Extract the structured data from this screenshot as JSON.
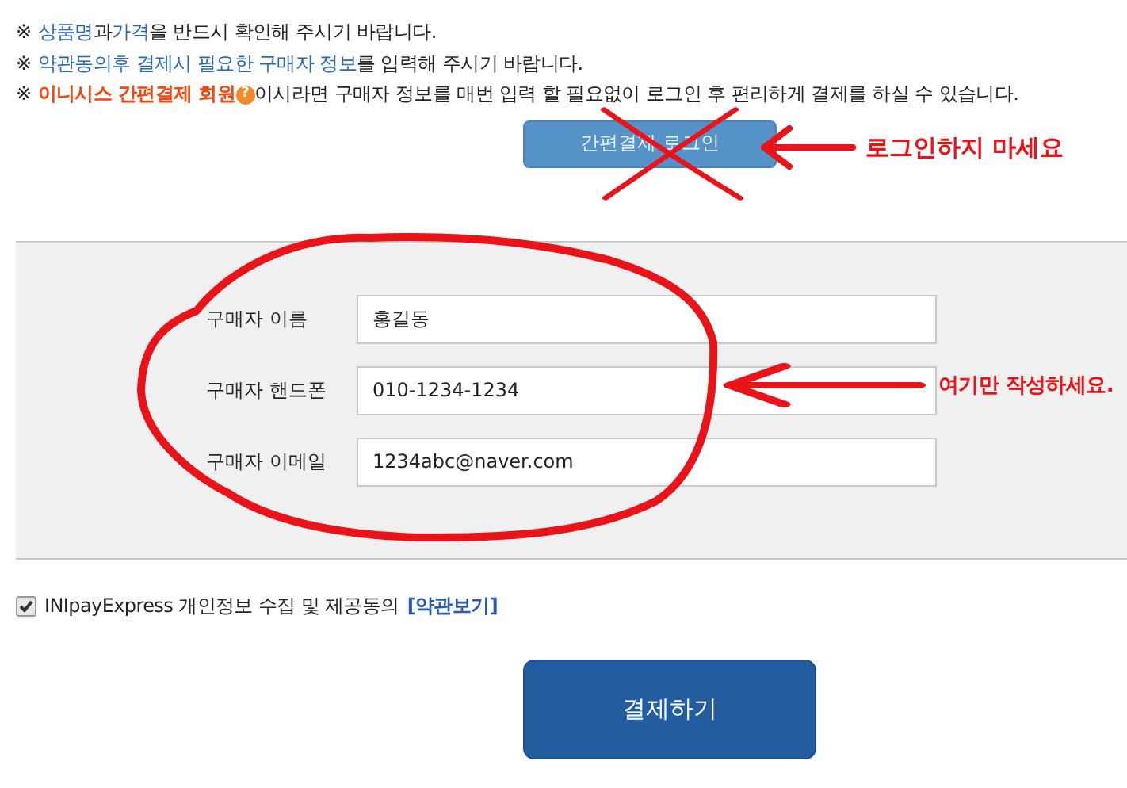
{
  "notices": [
    {
      "segments": [
        {
          "kind": "mark",
          "text": "※"
        },
        {
          "kind": "link",
          "text": "상품명"
        },
        {
          "kind": "plain",
          "text": "과 "
        },
        {
          "kind": "link",
          "text": "가격"
        },
        {
          "kind": "plain",
          "text": "을 반드시 확인해 주시기 바랍니다."
        }
      ]
    },
    {
      "segments": [
        {
          "kind": "mark",
          "text": "※"
        },
        {
          "kind": "link",
          "text": "약관동의후 결제시 필요한 구매자 정보"
        },
        {
          "kind": "plain",
          "text": "를 입력해 주시기 바랍니다."
        }
      ]
    },
    {
      "segments": [
        {
          "kind": "mark",
          "text": "※"
        },
        {
          "kind": "emph",
          "text": "이니시스 간편결제 회원"
        },
        {
          "kind": "help",
          "text": "?"
        },
        {
          "kind": "plain",
          "text": "이시라면 구매자 정보를 매번 입력 할 필요없이 로그인 후 편리하게 결제를 하실 수 있습니다."
        }
      ]
    }
  ],
  "login_button": {
    "label": "간편결제 로그인"
  },
  "form": {
    "fields": [
      {
        "label": "구매자 이름",
        "value": "홍길동"
      },
      {
        "label": "구매자 핸드폰",
        "value": "010-1234-1234"
      },
      {
        "label": "구매자 이메일",
        "value": "1234abc@naver.com"
      }
    ]
  },
  "agreement": {
    "checked": true,
    "text": "INIpayExpress 개인정보 수집 및 제공동의",
    "link": "[약관보기]"
  },
  "pay_button": {
    "label": "결제하기"
  },
  "annotations": [
    {
      "kind": "cross"
    },
    {
      "kind": "callout",
      "text": "로그인하지 마세요"
    },
    {
      "kind": "circle"
    },
    {
      "kind": "callout",
      "text": "여기만 작성하세요."
    }
  ]
}
